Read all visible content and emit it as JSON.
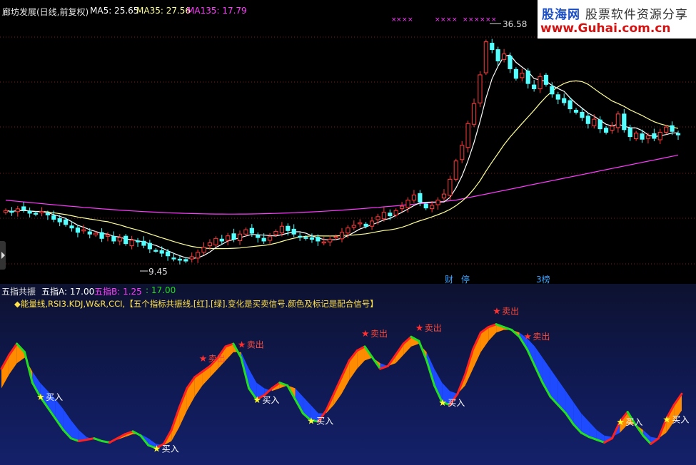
{
  "header": {
    "title": "廊坊发展(日线,前复权)",
    "ma5_label": "MA5: 25.65",
    "ma35_label": "MA35: 27.56",
    "ma135_label": "MA135: 17.79"
  },
  "watermark": {
    "brand": "股海网",
    "slogan": "股票软件资源分享",
    "url": "www.Guhai.com.cn"
  },
  "price_annotations": {
    "high": "36.58",
    "low": "9.45"
  },
  "event_tags": [
    "财",
    "停",
    "3榜"
  ],
  "indicator": {
    "name": "五指共振",
    "a_label": "五指A: 17.00",
    "b_label": "五指B: 1.25",
    "c_label": ": 17.00",
    "description": "◆能量线,RSI3.KDJ,W&R,CCI,【五个指标共振线.[红].[绿].变化是买卖信号.颜色及标记是配合信号】"
  },
  "signals": {
    "buy_text": "买入",
    "sell_text": "卖出"
  },
  "colors": {
    "up_candle": "#ff3b3b",
    "down_candle": "#54ffff",
    "ma5": "#ffffff",
    "ma35": "#ffff99",
    "ma135": "#ff3bff",
    "rise_fill": "#ff8c00",
    "fall_fill": "#1e4bff",
    "red_line": "#ff2020",
    "green_line": "#22dd22"
  },
  "chart_data": {
    "type": "candlestick",
    "price_ylim": [
      8,
      38
    ],
    "closes": [
      15.6,
      15.4,
      15.8,
      15.7,
      15.3,
      15.2,
      15.5,
      15.1,
      14.6,
      14.3,
      14.0,
      13.6,
      13.1,
      13.4,
      12.9,
      13.0,
      12.4,
      12.8,
      12.1,
      12.5,
      11.8,
      12.2,
      12.0,
      11.6,
      11.2,
      11.0,
      10.7,
      10.4,
      10.1,
      9.9,
      9.8,
      10.3,
      10.8,
      11.4,
      11.9,
      12.4,
      12.1,
      12.7,
      12.3,
      12.9,
      13.4,
      13.0,
      12.5,
      12.1,
      12.6,
      13.2,
      13.8,
      13.3,
      12.9,
      12.6,
      12.4,
      12.3,
      12.1,
      12.0,
      12.3,
      12.6,
      13.1,
      13.6,
      13.9,
      14.2,
      13.8,
      14.4,
      14.9,
      15.4,
      15.0,
      15.6,
      16.1,
      16.8,
      17.4,
      16.6,
      15.9,
      16.2,
      16.8,
      17.5,
      19.2,
      21.3,
      23.1,
      25.6,
      27.9,
      31.2,
      35.0,
      34.1,
      32.8,
      33.6,
      31.9,
      30.8,
      31.4,
      30.2,
      29.6,
      31.0,
      30.1,
      29.0,
      28.4,
      28.0,
      27.3,
      26.9,
      26.3,
      25.6,
      26.1,
      25.0,
      24.6,
      25.3,
      26.7,
      24.9,
      24.1,
      24.5,
      23.8,
      24.2,
      23.9,
      24.6,
      25.2,
      24.7,
      24.3
    ],
    "indicator_ylim": [
      0,
      100
    ],
    "indicator_fast": [
      62,
      72,
      80,
      74,
      52,
      42,
      34,
      26,
      18,
      12,
      10,
      11,
      12,
      10,
      9,
      12,
      15,
      17,
      14,
      7,
      5,
      8,
      18,
      34,
      48,
      56,
      60,
      64,
      70,
      78,
      80,
      70,
      48,
      40,
      43,
      48,
      52,
      50,
      40,
      30,
      25,
      24,
      32,
      44,
      56,
      68,
      75,
      78,
      70,
      62,
      64,
      72,
      80,
      85,
      82,
      68,
      50,
      38,
      36,
      44,
      58,
      76,
      88,
      92,
      94,
      92,
      90,
      85,
      76,
      64,
      52,
      42,
      36,
      30,
      22,
      16,
      13,
      11,
      9,
      12,
      24,
      31,
      22,
      14,
      8,
      12,
      26,
      36,
      44
    ],
    "indicator_slow": [
      48,
      58,
      66,
      70,
      60,
      52,
      46,
      40,
      33,
      25,
      18,
      13,
      11,
      10,
      10,
      11,
      13,
      15,
      15,
      12,
      8,
      7,
      10,
      20,
      32,
      42,
      50,
      56,
      62,
      68,
      74,
      74,
      62,
      52,
      48,
      46,
      48,
      50,
      48,
      42,
      36,
      30,
      30,
      36,
      44,
      54,
      62,
      68,
      70,
      66,
      64,
      66,
      72,
      78,
      80,
      74,
      62,
      52,
      46,
      44,
      50,
      62,
      74,
      82,
      88,
      90,
      90,
      88,
      84,
      78,
      70,
      62,
      54,
      46,
      38,
      30,
      24,
      18,
      14,
      13,
      16,
      22,
      22,
      18,
      13,
      12,
      16,
      24,
      32
    ],
    "buy_signal_indices": [
      5,
      20,
      33,
      40,
      57,
      80,
      86
    ],
    "sell_signal_indices": [
      26,
      31,
      47,
      54,
      64,
      68
    ]
  }
}
